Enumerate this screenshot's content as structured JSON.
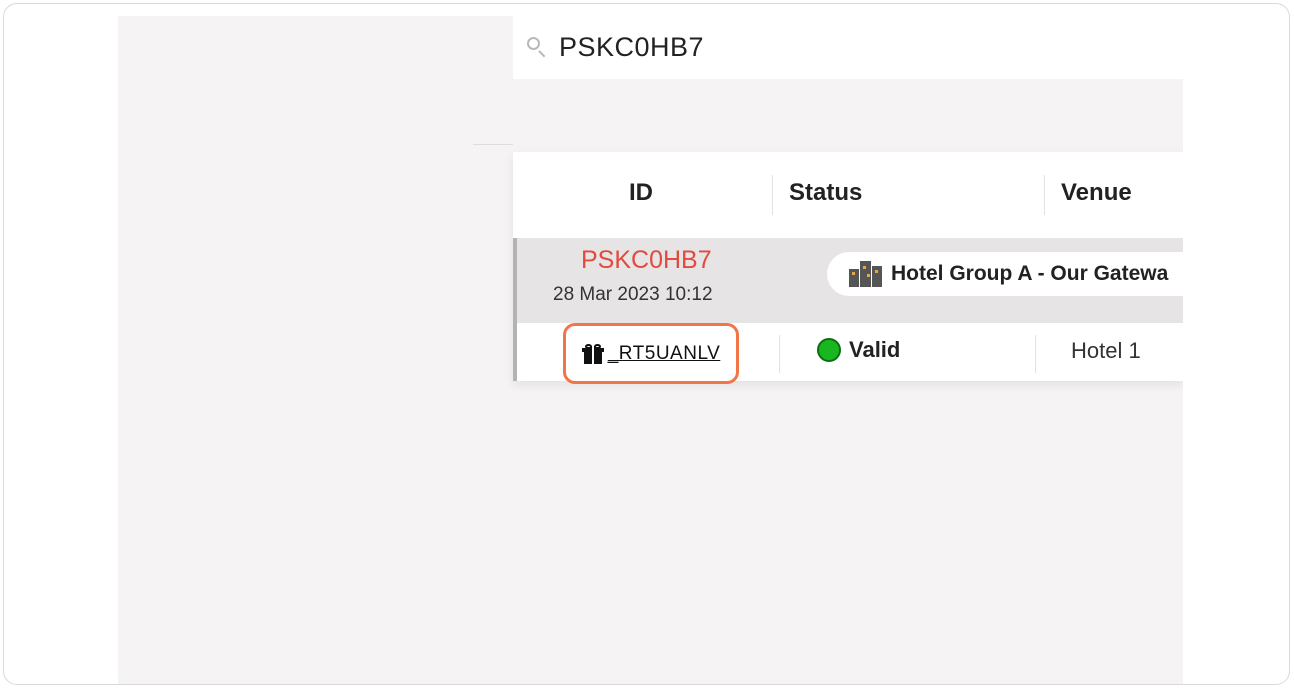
{
  "search": {
    "value": "PSKC0HB7",
    "icon": "search-icon"
  },
  "table": {
    "columns": [
      "ID",
      "Status",
      "Venue"
    ],
    "group": {
      "booking_id": "PSKC0HB7",
      "booking_date": "28 Mar 2023 10:12",
      "venue_label": "Hotel Group A - Our Gatewa",
      "venue_icon": "building-icon"
    },
    "rows": [
      {
        "voucher_code": "_RT5UANLV",
        "voucher_icon": "gift-icon",
        "status": "Valid",
        "status_color": "#18b61f",
        "venue": "Hotel 1"
      }
    ]
  },
  "colors": {
    "booking_id": "#e34a3e",
    "highlight_border": "#f07648",
    "app_background": "#f5f3f3"
  }
}
